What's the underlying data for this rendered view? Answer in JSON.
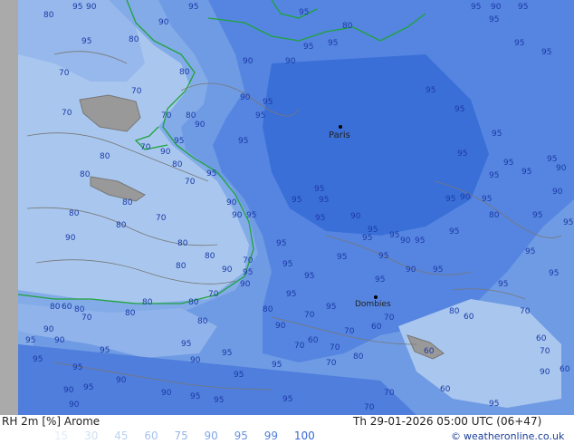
{
  "map": {
    "colors": {
      "sea": "#a9c7ee",
      "land_low": "#91b8ea",
      "rh90": "#6f9be4",
      "rh95": "#5585e0",
      "rh100": "#3a6fd8",
      "coast": "#1fa33a",
      "contour": "#777777",
      "label": "#1c3aa8",
      "gray_left": "#aaaaaa"
    },
    "city": {
      "name": "Paris"
    },
    "city2": {
      "name": "Dombies"
    },
    "contour_labels": [
      "95",
      "90",
      "80",
      "70",
      "60"
    ]
  },
  "footer": {
    "title": "RH 2m [%] Arome",
    "datetime": "Th 29-01-2026 05:00 UTC (06+47)",
    "credit_symbol": "©",
    "credit": "weatheronline.co.uk",
    "legend": [
      {
        "label": "15",
        "color": "#e2ecf9"
      },
      {
        "label": "30",
        "color": "#cfdff5"
      },
      {
        "label": "45",
        "color": "#bcd1f2"
      },
      {
        "label": "60",
        "color": "#a9c3ef"
      },
      {
        "label": "75",
        "color": "#96b5ec"
      },
      {
        "label": "90",
        "color": "#82a6e8"
      },
      {
        "label": "95",
        "color": "#6a93e2"
      },
      {
        "label": "99",
        "color": "#4f7ddc"
      },
      {
        "label": "100",
        "color": "#3568d6"
      }
    ]
  }
}
